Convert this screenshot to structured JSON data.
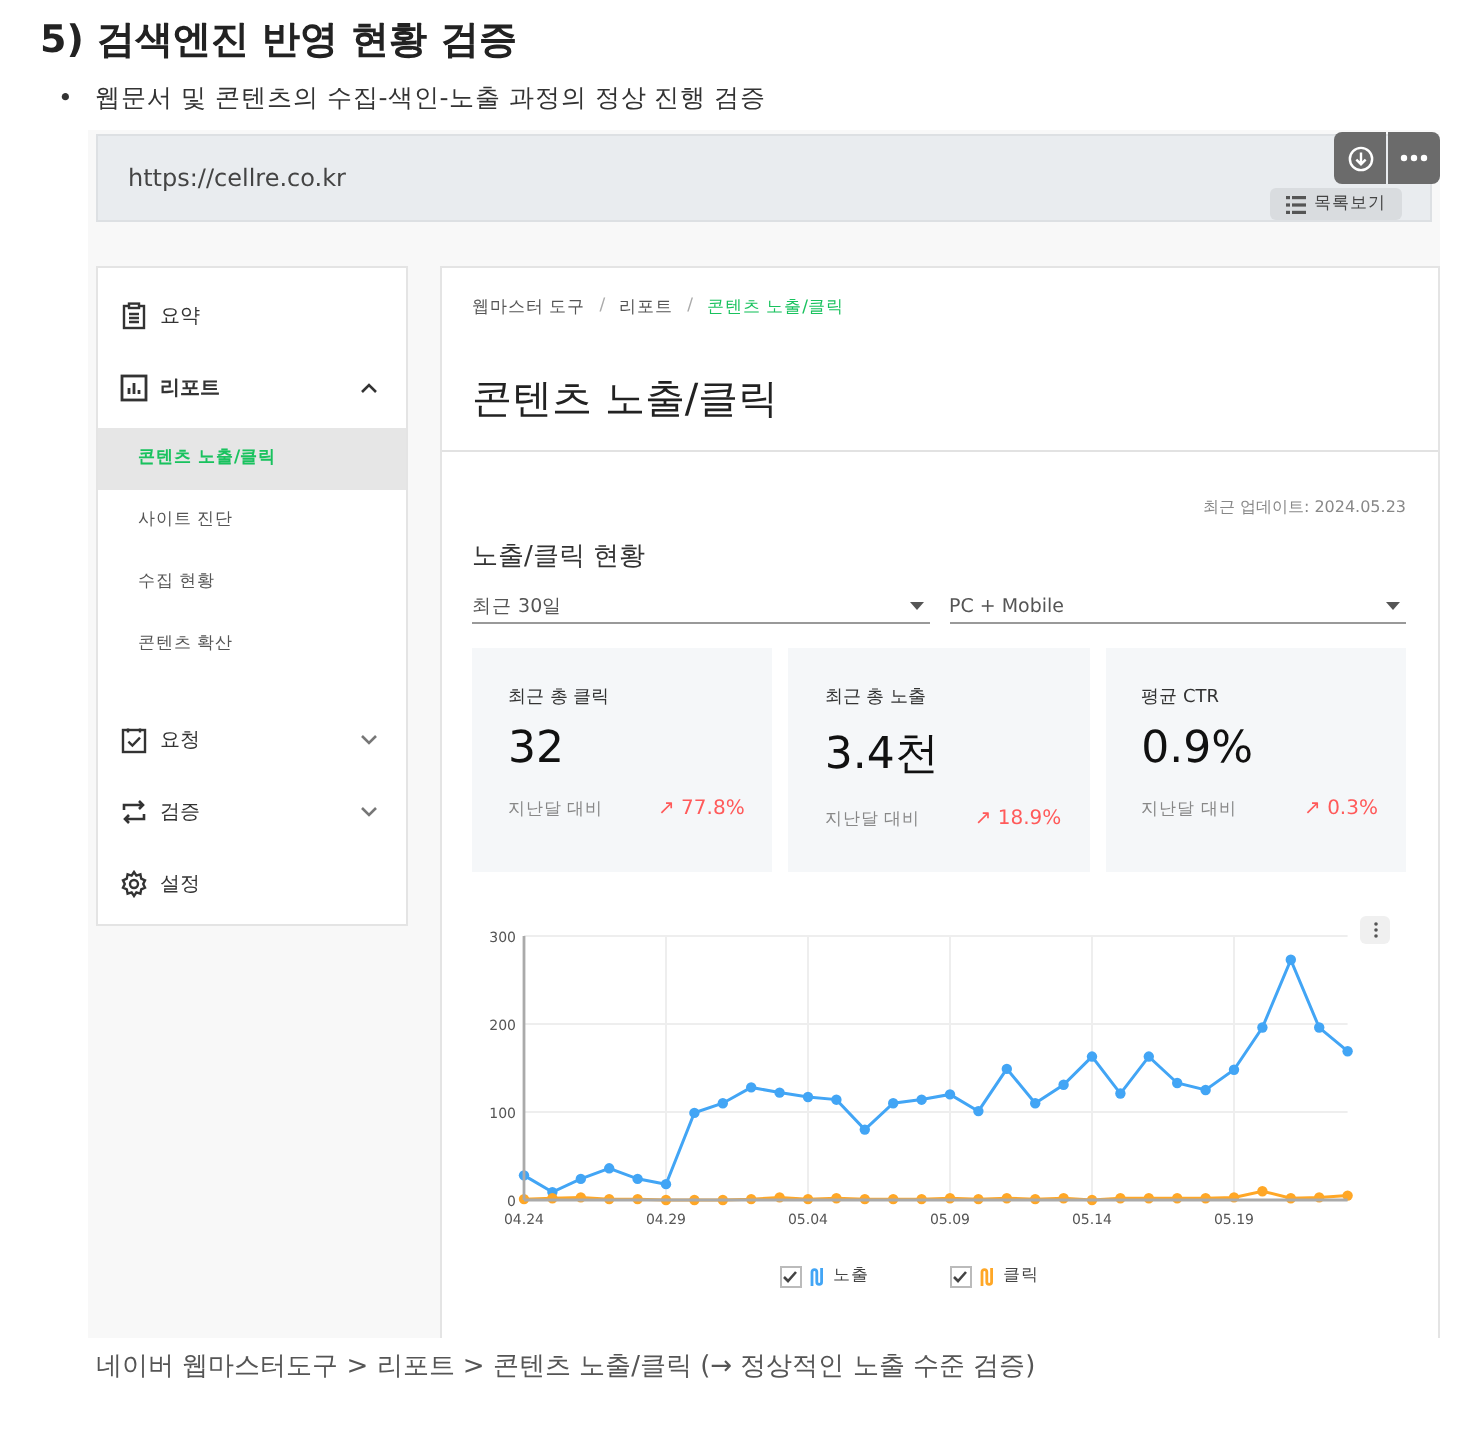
{
  "heading": "5) 검색엔진 반영 현황 검증",
  "bullets": [
    {
      "marker": "•",
      "text": "웹문서 및 콘텐츠의 수집-색인-노출 과정의 정상 진행 검증"
    }
  ],
  "screenshot": {
    "url": "https://cellre.co.kr",
    "list_button": "목록보기",
    "sidebar": {
      "items": [
        {
          "label": "요약"
        },
        {
          "label": "리포트",
          "expanded": true,
          "children": [
            {
              "label": "콘텐츠 노출/클릭",
              "selected": true
            },
            {
              "label": "사이트 진단",
              "selected": false
            },
            {
              "label": "수집 현황",
              "selected": false
            },
            {
              "label": "콘텐츠 확산",
              "selected": false
            }
          ]
        },
        {
          "label": "요청",
          "expanded": false
        },
        {
          "label": "검증",
          "expanded": false
        },
        {
          "label": "설정"
        }
      ]
    },
    "breadcrumb_separator": "/",
    "breadcrumb": [
      {
        "label": "웹마스터 도구",
        "selected": false
      },
      {
        "label": "리포트",
        "selected": false
      },
      {
        "label": "콘텐츠 노출/클릭",
        "selected": true
      }
    ],
    "page_title": "콘텐츠 노출/클릭",
    "updated": "최근 업데이트: 2024.05.23",
    "section_title": "노출/클릭 현황",
    "filters": [
      {
        "value": "최근 30일"
      },
      {
        "value": "PC + Mobile"
      }
    ],
    "stats": [
      {
        "label": "최근 총 클릭",
        "value": "32",
        "compare_label": "지난달 대비",
        "change": "↗ 77.8%"
      },
      {
        "label": "최근 총 노출",
        "value": "3.4천",
        "compare_label": "지난달 대비",
        "change": "↗ 18.9%"
      },
      {
        "label": "평균 CTR",
        "value": "0.9%",
        "compare_label": "지난달 대비",
        "change": "↗ 0.3%"
      }
    ],
    "chart_data": {
      "type": "line",
      "categories": [
        "04.24",
        null,
        null,
        null,
        null,
        "04.29",
        null,
        null,
        null,
        null,
        "05.04",
        null,
        null,
        null,
        null,
        "05.09",
        null,
        null,
        null,
        null,
        "05.14",
        null,
        null,
        null,
        null,
        "05.19",
        null,
        null,
        null,
        null
      ],
      "grid": true,
      "series": [
        {
          "name": "노출",
          "color": "#42a5f5",
          "marker": "circle",
          "values": [
            28,
            9,
            24,
            36,
            24,
            18,
            99,
            110,
            128,
            122,
            117,
            114,
            80,
            110,
            114,
            120,
            101,
            149,
            110,
            131,
            163,
            121,
            163,
            133,
            125,
            148,
            196,
            273,
            196,
            169
          ]
        },
        {
          "name": "클릭",
          "color": "#ffa726",
          "marker": "circle",
          "values": [
            1,
            2,
            3,
            1,
            1,
            0,
            0,
            0,
            1,
            3,
            1,
            2,
            1,
            1,
            1,
            2,
            1,
            2,
            1,
            2,
            0,
            2,
            2,
            2,
            2,
            3,
            10,
            2,
            3,
            5
          ]
        }
      ],
      "ylim": [
        0,
        300
      ],
      "yticks": [
        0,
        100,
        200,
        300
      ]
    },
    "legend": [
      {
        "checked": true
      },
      {
        "checked": true
      }
    ]
  },
  "caption": "네이버 웹마스터도구 > 리포트 > 콘텐츠 노출/클릭 (→ 정상적인 노출 수준 검증)"
}
